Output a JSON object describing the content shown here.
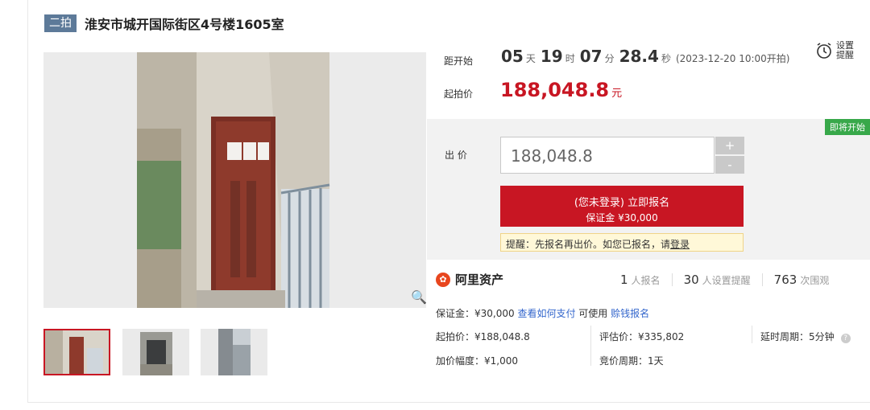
{
  "header": {
    "badge": "二拍",
    "title": "淮安市城开国际街区4号楼1605室"
  },
  "countdown": {
    "label": "距开始",
    "days": "05",
    "days_unit": "天",
    "hours": "19",
    "hours_unit": "时",
    "minutes": "07",
    "minutes_unit": "分",
    "seconds": "28.4",
    "seconds_unit": "秒",
    "start_time": "(2023-12-20 10:00开拍)"
  },
  "reminder": {
    "label": "设置提醒",
    "icon": "alarm-clock-icon"
  },
  "start_price": {
    "label": "起拍价",
    "value": "188,048.8",
    "unit": "元"
  },
  "bid": {
    "status_badge": "即将开始",
    "label": "出 价",
    "input_value": "188,048.8",
    "plus": "+",
    "minus": "-",
    "signup_line1": "(您未登录) 立即报名",
    "signup_line2": "保证金 ¥30,000",
    "notice_text": "提醒：先报名再出价。如您已报名，请",
    "notice_link": "登录"
  },
  "platform": {
    "name": "阿里资产",
    "signups_count": "1",
    "signups_label": "人报名",
    "reminders_count": "30",
    "reminders_label": "人设置提醒",
    "views_count": "763",
    "views_label": "次围观"
  },
  "details": {
    "deposit": "保证金：¥30,000",
    "how_to_pay": "查看如何支付",
    "usable": "可使用",
    "loan_signup": "赊钱报名",
    "start_price": "起拍价：¥188,048.8",
    "appraisal": "评估价：¥335,802",
    "delay": "延时周期：5分钟",
    "increment": "加价幅度：¥1,000",
    "bid_period": "竞价周期：1天"
  },
  "colors": {
    "accent": "#c81623",
    "badge": "#5d7a99",
    "status": "#38a84a",
    "link": "#3366cc"
  }
}
